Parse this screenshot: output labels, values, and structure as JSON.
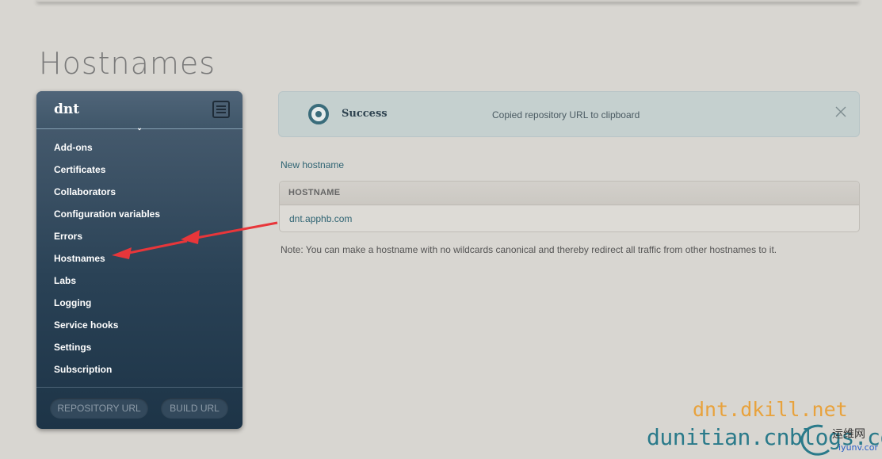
{
  "page": {
    "title": "Hostnames"
  },
  "sidebar": {
    "app_name": "dnt",
    "items": [
      {
        "label": "Add-ons"
      },
      {
        "label": "Certificates"
      },
      {
        "label": "Collaborators"
      },
      {
        "label": "Configuration variables"
      },
      {
        "label": "Errors"
      },
      {
        "label": "Hostnames"
      },
      {
        "label": "Labs"
      },
      {
        "label": "Logging"
      },
      {
        "label": "Service hooks"
      },
      {
        "label": "Settings"
      },
      {
        "label": "Subscription"
      }
    ],
    "repository_url_label": "REPOSITORY URL",
    "build_url_label": "BUILD URL"
  },
  "notice": {
    "title": "Success",
    "message": "Copied repository URL to clipboard"
  },
  "content": {
    "new_hostname_label": "New hostname",
    "table_header": "HOSTNAME",
    "rows": [
      {
        "hostname": "dnt.apphb.com"
      }
    ],
    "note": "Note: You can make a hostname with no wildcards canonical and thereby redirect all traffic from other hostnames to it."
  },
  "watermark": {
    "line1": "dnt.dkill.net",
    "line2": "dunitian.cnblogs.com",
    "logo_text": "运维网",
    "logo_sub": "iyunv.com"
  },
  "colors": {
    "background": "#d8d6d1",
    "sidebar": "#2a4256",
    "notice": "#c5d0cf",
    "link": "#2f6473",
    "annotation_arrow": "#e8363a"
  }
}
